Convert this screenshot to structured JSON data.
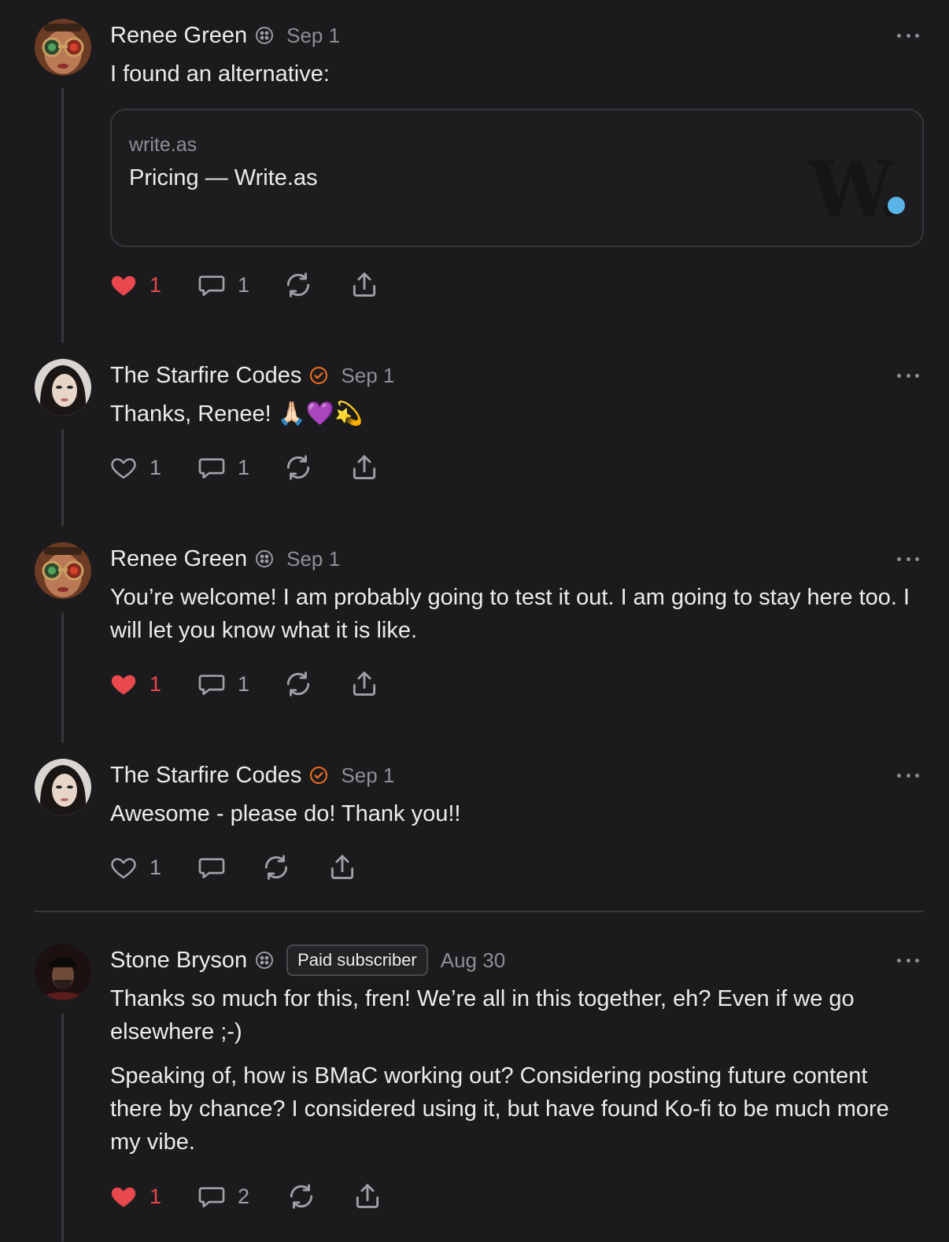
{
  "comments": [
    {
      "author": "Renee Green",
      "date": "Sep 1",
      "text": [
        "I found an alternative:"
      ],
      "link": {
        "domain": "write.as",
        "title": "Pricing — Write.as",
        "logo_letter": "W."
      },
      "likes": "1",
      "replies": "1",
      "liked": true
    },
    {
      "author": "The Starfire Codes",
      "date": "Sep 1",
      "text": [
        "Thanks, Renee! 🙏🏻💜💫"
      ],
      "likes": "1",
      "replies": "1",
      "liked": false
    },
    {
      "author": "Renee Green",
      "date": "Sep 1",
      "text": [
        "You’re welcome! I am probably going to test it out. I am going to stay here too. I will let you know what it is like."
      ],
      "likes": "1",
      "replies": "1",
      "liked": true
    },
    {
      "author": "The Starfire Codes",
      "date": "Sep 1",
      "text": [
        "Awesome - please do! Thank you!!"
      ],
      "likes": "1",
      "replies": "",
      "liked": false
    },
    {
      "author": "Stone Bryson",
      "badge_label": "Paid subscriber",
      "date": "Aug 30",
      "text": [
        "Thanks so much for this, fren! We’re all in this together, eh? Even if we go elsewhere ;-)",
        "Speaking of, how is BMaC working out? Considering posting future content there by chance? I considered using it, but have found Ko-fi to be much more my vibe."
      ],
      "likes": "1",
      "replies": "2",
      "liked": true
    }
  ],
  "colors": {
    "background": "#1b1b1e",
    "like_active": "#e8484e",
    "verified": "#f26d21",
    "muted": "#8e8e93",
    "thread_line": "#38383c"
  },
  "icons": [
    "heart-icon",
    "comment-bubble-icon",
    "restack-icon",
    "share-icon",
    "more-icon",
    "verified-icon",
    "badge-icon"
  ]
}
